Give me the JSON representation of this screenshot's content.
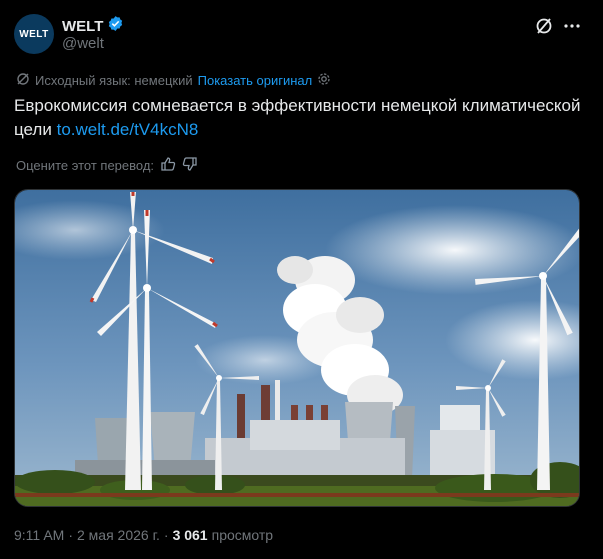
{
  "header": {
    "avatar_text": "WELT",
    "name": "WELT",
    "handle": "@welt"
  },
  "translation": {
    "source_label": "Исходный язык: немецкий",
    "show_original": "Показать оригинал"
  },
  "tweet": {
    "text": "Еврокомиссия сомневается в эффективности немецкой климатической цели",
    "url": "to.welt.de/tV4kcN8"
  },
  "rating": {
    "label": "Оцените этот перевод:"
  },
  "meta": {
    "time": "9:11 AM",
    "sep1": "·",
    "date": "2 мая 2026 г.",
    "sep2": "·",
    "views_count": "3 061",
    "views_label": "просмотр"
  },
  "colors": {
    "accent": "#1d9bf0",
    "verified": "#1d9bf0",
    "muted": "#71767b",
    "text": "#e7e9ea",
    "background": "#000000"
  },
  "icons": [
    "verified-badge-icon",
    "grok-icon",
    "more-icon",
    "translate-icon",
    "gear-icon",
    "thumbs-up-icon",
    "thumbs-down-icon"
  ]
}
